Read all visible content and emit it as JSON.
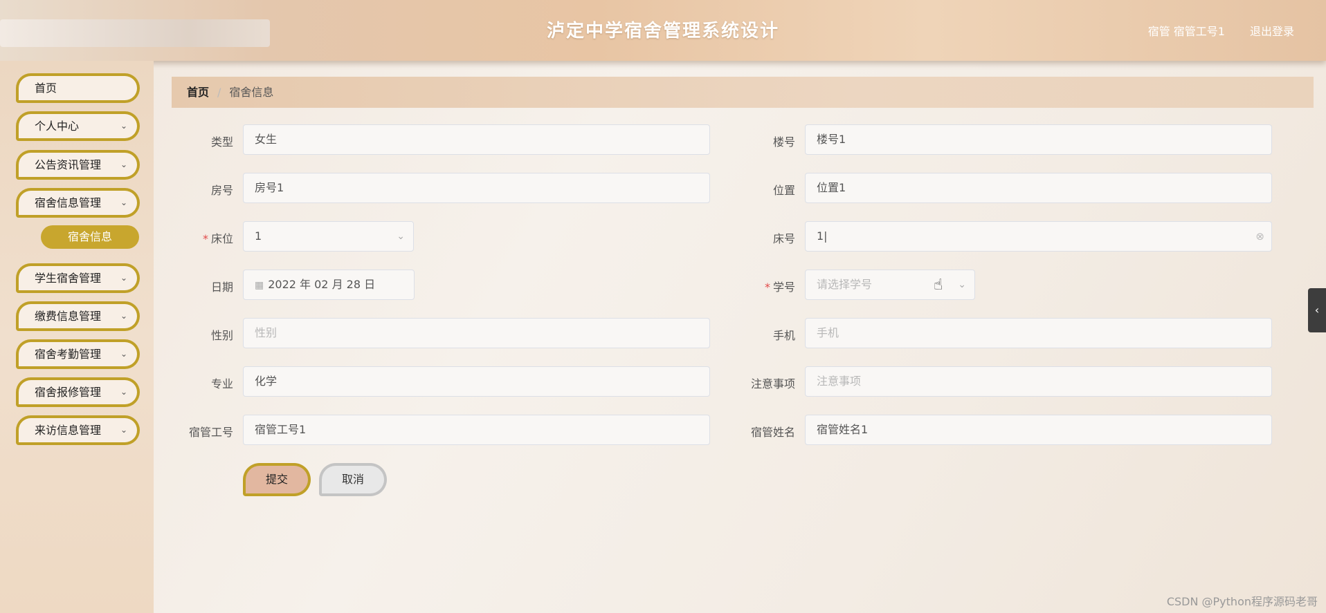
{
  "header": {
    "title": "泸定中学宿舍管理系统设计",
    "user": "宿管  宿管工号1",
    "logout": "退出登录"
  },
  "sidebar": {
    "items": [
      {
        "label": "首页",
        "has_chevron": false
      },
      {
        "label": "个人中心",
        "has_chevron": true
      },
      {
        "label": "公告资讯管理",
        "has_chevron": true
      },
      {
        "label": "宿舍信息管理",
        "has_chevron": true
      },
      {
        "label": "学生宿舍管理",
        "has_chevron": true
      },
      {
        "label": "缴费信息管理",
        "has_chevron": true
      },
      {
        "label": "宿舍考勤管理",
        "has_chevron": true
      },
      {
        "label": "宿舍报修管理",
        "has_chevron": true
      },
      {
        "label": "来访信息管理",
        "has_chevron": true
      }
    ],
    "active_sub": "宿舍信息"
  },
  "breadcrumb": {
    "home": "首页",
    "sep": "/",
    "current": "宿舍信息"
  },
  "form": {
    "type_label": "类型",
    "type_value": "女生",
    "building_label": "楼号",
    "building_value": "楼号1",
    "room_label": "房号",
    "room_value": "房号1",
    "location_label": "位置",
    "location_value": "位置1",
    "bed_label": "床位",
    "bed_value": "1",
    "bed_no_label": "床号",
    "bed_no_value": "1|",
    "date_label": "日期",
    "date_value": "2022 年 02 月 28 日",
    "student_id_label": "学号",
    "student_id_placeholder": "请选择学号",
    "gender_label": "性别",
    "gender_placeholder": "性别",
    "phone_label": "手机",
    "phone_placeholder": "手机",
    "major_label": "专业",
    "major_value": "化学",
    "notes_label": "注意事项",
    "notes_placeholder": "注意事项",
    "warden_id_label": "宿管工号",
    "warden_id_value": "宿管工号1",
    "warden_name_label": "宿管姓名",
    "warden_name_value": "宿管姓名1",
    "required_mark": "*"
  },
  "buttons": {
    "submit": "提交",
    "cancel": "取消"
  },
  "icons": {
    "chevron": "chevron-down-icon",
    "calendar": "calendar-icon",
    "clear": "circle-close-icon",
    "side_tab": "chevron-left-icon",
    "cursor": "hand-pointer-icon"
  },
  "watermark": "CSDN @Python程序源码老哥",
  "colors": {
    "accent_gold": "#c0a028",
    "submenu_active": "#c8a62e",
    "submit_bg": "#e2b7a0",
    "required": "#e24a4a"
  }
}
